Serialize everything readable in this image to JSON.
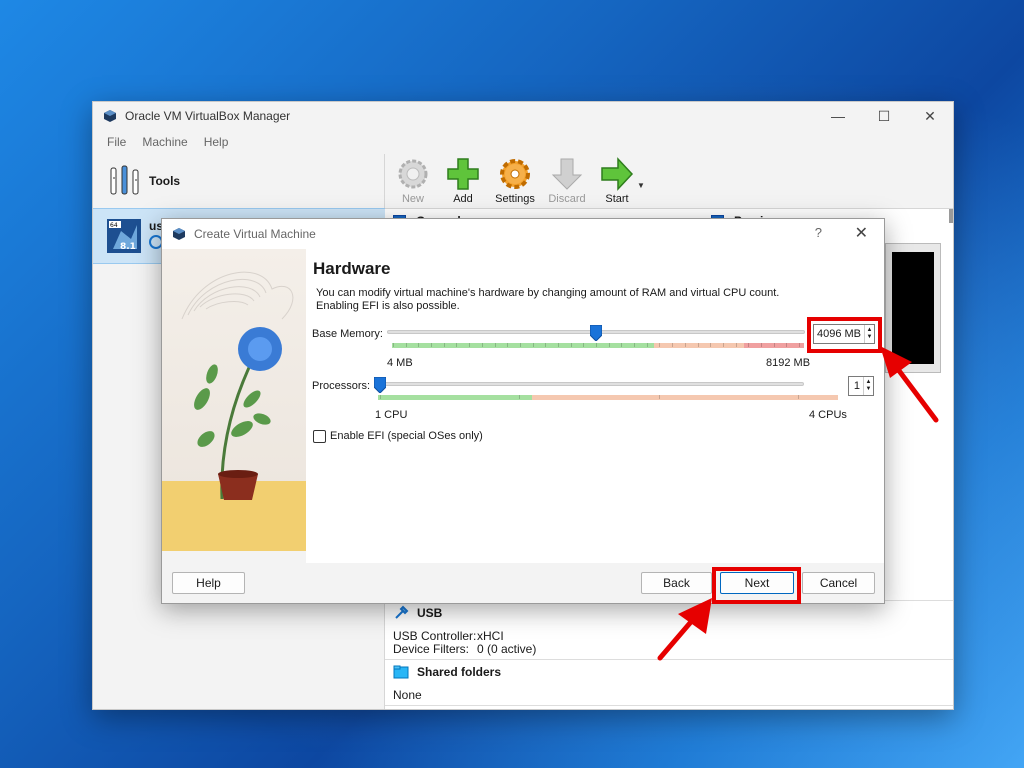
{
  "main_window": {
    "title": "Oracle VM VirtualBox Manager",
    "menu": [
      "File",
      "Machine",
      "Help"
    ],
    "tools_label": "Tools",
    "vm_name": "us",
    "vm_badge": "8.1",
    "toolbar": [
      {
        "label": "New",
        "icon": "new-gear-icon",
        "enabled": false
      },
      {
        "label": "Add",
        "icon": "add-plus-icon",
        "enabled": true
      },
      {
        "label": "Settings",
        "icon": "settings-gear-icon",
        "enabled": true
      },
      {
        "label": "Discard",
        "icon": "discard-arrow-icon",
        "enabled": false
      },
      {
        "label": "Start",
        "icon": "start-arrow-icon",
        "enabled": true
      }
    ],
    "sections": {
      "general": "General",
      "preview": "Preview",
      "usb": {
        "title": "USB",
        "controller_label": "USB Controller:",
        "controller_value": "xHCI",
        "filters_label": "Device Filters:",
        "filters_value": "0 (0 active)"
      },
      "shared_folders": {
        "title": "Shared folders",
        "value": "None"
      }
    }
  },
  "dialog": {
    "title": "Create Virtual Machine",
    "help_glyph": "?",
    "page_title": "Hardware",
    "description_line1": "You can modify virtual machine's hardware by changing amount of RAM and virtual CPU count.",
    "description_line2": "Enabling EFI is also possible.",
    "base_memory": {
      "label": "Base Memory:",
      "value": "4096 MB",
      "min_label": "4 MB",
      "max_label": "8192 MB",
      "min": 4,
      "max": 8192,
      "current": 4096
    },
    "processors": {
      "label": "Processors:",
      "value": "1",
      "min_label": "1 CPU",
      "max_label": "4 CPUs",
      "min": 1,
      "max": 4,
      "current": 1
    },
    "efi": {
      "label": "Enable EFI (special OSes only)",
      "checked": false
    },
    "buttons": {
      "help": "Help",
      "back": "Back",
      "next": "Next",
      "cancel": "Cancel"
    }
  },
  "colors": {
    "highlight": "#e60000",
    "slider_green": "#a5e0a0",
    "slider_orange": "#f5c8b0",
    "slider_red": "#f0a0a0",
    "selection": "#cce4f7",
    "accent": "#0067c0"
  }
}
